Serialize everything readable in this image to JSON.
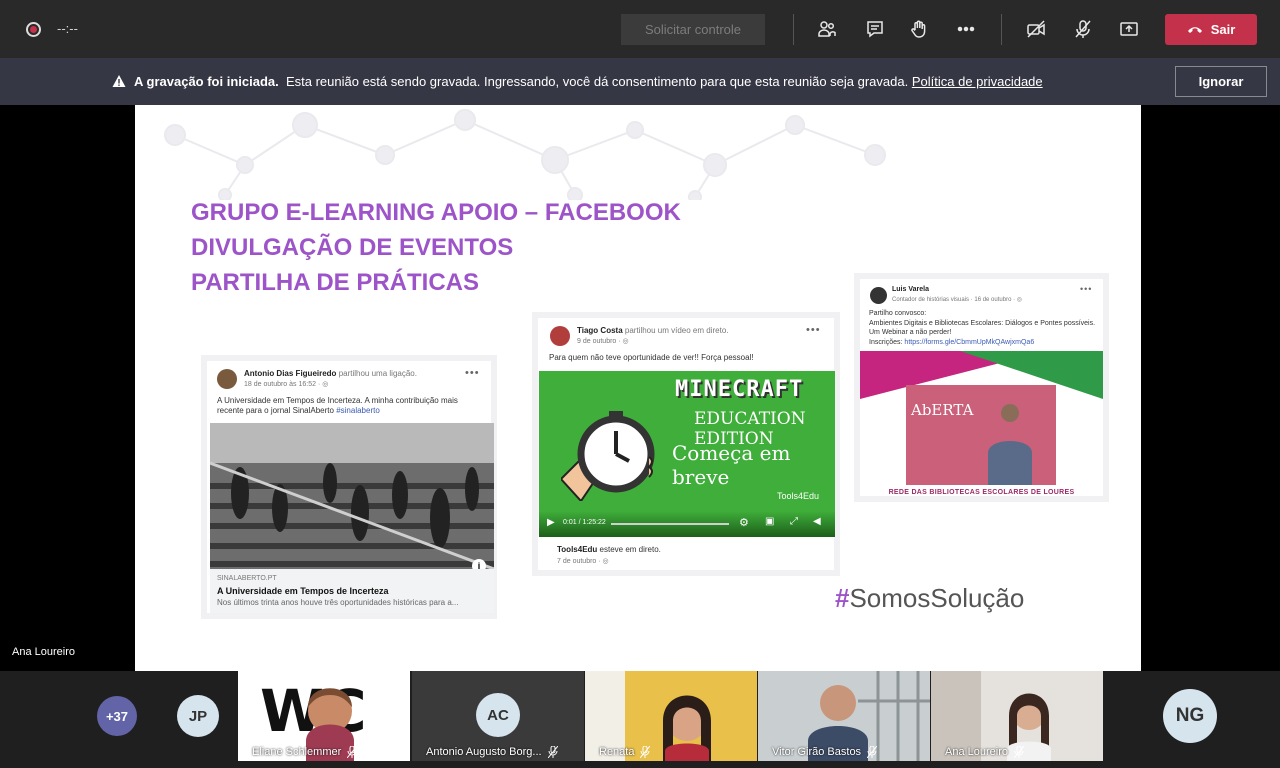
{
  "toolbar": {
    "timer": "--:--",
    "request_control_label": "Solicitar controle",
    "leave_label": "Sair",
    "icons": [
      "people-icon",
      "chat-icon",
      "raise-hand-icon",
      "more-options-icon",
      "camera-off-icon",
      "mic-off-icon",
      "share-screen-icon"
    ]
  },
  "banner": {
    "bold": "A gravação foi iniciada.",
    "text": "Esta reunião está sendo gravada. Ingressando, você dá consentimento para que esta reunião seja gravada.",
    "link": "Política de privacidade",
    "ignore_label": "Ignorar"
  },
  "slide": {
    "title_lines": [
      "GRUPO E-LEARNING APOIO – FACEBOOK",
      "DIVULGAÇÃO DE EVENTOS",
      "PARTILHA DE PRÁTICAS"
    ],
    "hashtag_symbol": "#",
    "hashtag_text": "SomosSolução",
    "post1": {
      "author": "Antonio Dias Figueiredo",
      "action": "partilhou uma ligação.",
      "date": "18 de outubro às 16:52 · ",
      "text": "A Universidade em Tempos de Incerteza. A minha contribuição mais recente para o jornal SinalAberto",
      "tag": "#sinalaberto",
      "link_domain": "SINALABERTO.PT",
      "link_title": "A Universidade em Tempos de Incerteza",
      "link_desc": "Nos últimos trinta anos houve três oportunidades históricas para a..."
    },
    "post2": {
      "author": "Tiago Costa",
      "action": "partilhou um vídeo em direto.",
      "date": "9 de outubro · ",
      "text": "Para quem não teve oportunidade de ver!! Força pessoal!",
      "video_title": "MINECRAFT",
      "video_sub": "EDUCATION EDITION",
      "video_tagline": "Começa em breve",
      "video_brand": "Tools4Edu",
      "video_time": "0:01 / 1:25:22",
      "live_author": "Tools4Edu",
      "live_action": "esteve em direto.",
      "live_date": "7 de outubro · "
    },
    "post3": {
      "author": "Luis Varela",
      "role": "Contador de histórias visuais · 16 de outubro · ",
      "text1": "Partilho convosco:",
      "text2": "Ambientes Digitais e Bibliotecas Escolares: Diálogos e Pontes possíveis.",
      "text3": "Um Webinar a não perder!",
      "text4": "Inscrições:",
      "link": "https://forms.gle/CbmmUpMkQAwjxmQa6",
      "image_word": "AbERTA",
      "footer": "REDE DAS BIBLIOTECAS ESCOLARES DE LOURES"
    }
  },
  "presenter_name": "Ana Loureiro",
  "participants": {
    "more_count": "+37",
    "initials_left": "JP",
    "initials_right": "NG",
    "tiles": [
      {
        "name": "Eliane Schlemmer"
      },
      {
        "name": "Antonio Augusto Borg...",
        "initials": "AC"
      },
      {
        "name": "Renata"
      },
      {
        "name": "Vitor Girão Bastos"
      },
      {
        "name": "Ana Loureiro"
      }
    ]
  }
}
